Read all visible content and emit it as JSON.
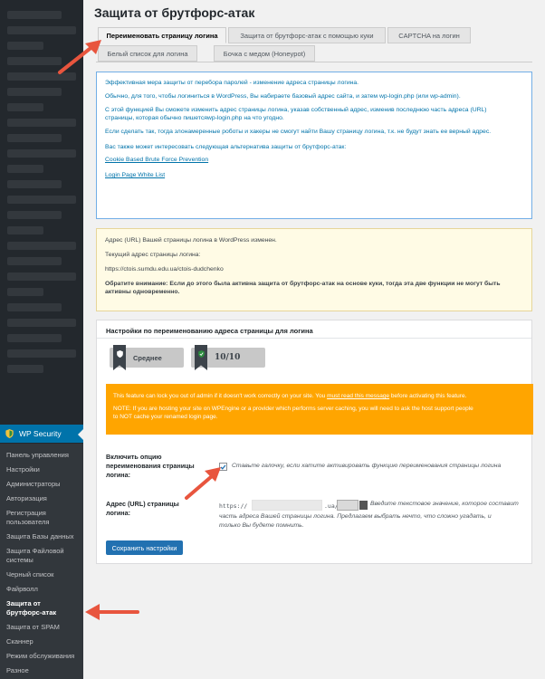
{
  "page": {
    "title": "Защита от брутфорс-атак"
  },
  "tabs": [
    {
      "label": "Переименовать страницу логина",
      "active": true
    },
    {
      "label": "Защита от брутфорс-атак с помощью куки",
      "active": false
    },
    {
      "label": "CAPTCHA на логин",
      "active": false
    },
    {
      "label": "Белый список для логина",
      "active": false
    },
    {
      "label": "Бочка с медом (Honeypot)",
      "active": false
    }
  ],
  "info_box": {
    "p1": "Эффективная мера защиты от перебора паролей - изменение адреса страницы логина.",
    "p2": "Обычно, для того, чтобы логиниться в WordPress, Вы набираете базовый адрес сайта, и затем wp-login.php (или wp-admin).",
    "p3_a": "С этой функцией Вы сможете изменить адрес страницы логина, указав собственный адрес, изменив последнюю часть адреса (URL)",
    "p3_b": "страницы, которая обычно пишетсяwp-login.php на что угодно.",
    "p4": "Если сделать так, тогда злонамеренные роботы и хакеры не смогут найти Вашу страницу логина, т.к. не будут знать ее верный адрес.",
    "p5": "Вас также может интересовать следующая альтернатива защиты от брутфорс-атак:",
    "link1": "Cookie Based Brute Force Prevention",
    "link2": "Login Page White List"
  },
  "warn_box": {
    "p1": "Адрес (URL) Вашей страницы логина в WordPress изменен.",
    "p2": "Текущий адрес страницы логина:",
    "p3": "https://ctois.sumdu.edu.ua/ctois-dudchenko",
    "p4_a": "Обратите внимание: Если до этого была активна защита от брутфорс-атак на основе куки, тогда эта две функции не могут быть",
    "p4_b": "активны одновременно."
  },
  "settings": {
    "heading": "Настройки по переименованию адреса страницы для логина",
    "badge_level": "Среднее",
    "badge_score": "10/10",
    "orange_p1_a": "This feature can lock you out of admin if it doesn't work correctly on your site. You ",
    "orange_link": "must read this message",
    "orange_p1_b": " before activating this feature.",
    "orange_p2_a": "NOTE: If you are hosting your site on WPEngine or a provider which performs server caching, you will need to ask the host support people",
    "orange_p2_b": "to NOT cache your renamed login page.",
    "enable_label_1": "Включить опцию",
    "enable_label_2": "переименования страницы",
    "enable_label_3": "логина:",
    "enable_checked": true,
    "enable_hint": "Ставьте галочку, если хатите активировать функцию переименования страницы логина",
    "url_label_1": "Адрес (URL) страницы",
    "url_label_2": "логина:",
    "url_prefix": "https://",
    "url_suffix": ".ua/",
    "url_hint_1": "Введите текстовое значение, которое составит",
    "url_hint_2": "часть адреса Вашей страницы логина. Предлагаем выбрать нечто, что сложно угадать, и",
    "url_hint_3": "только Вы будете помнить.",
    "save_label": "Сохранить настройки"
  },
  "sidebar": {
    "plugin_label": "WP Security",
    "items": [
      {
        "label": "Панель управления",
        "active": false
      },
      {
        "label": "Настройки",
        "active": false
      },
      {
        "label": "Администраторы",
        "active": false
      },
      {
        "label": "Авторизация",
        "active": false
      },
      {
        "label": "Регистрация пользователя",
        "active": false
      },
      {
        "label": "Защита Базы данных",
        "active": false
      },
      {
        "label": "Защита Файловой системы",
        "active": false
      },
      {
        "label": "Черный список",
        "active": false
      },
      {
        "label": "Файрволл",
        "active": false
      },
      {
        "label": "Защита от брутфорс-атак",
        "active": true
      },
      {
        "label": "Защита от SPAM",
        "active": false
      },
      {
        "label": "Сканнер",
        "active": false
      },
      {
        "label": "Режим обслуживания",
        "active": false
      },
      {
        "label": "Разное",
        "active": false
      }
    ]
  },
  "colors": {
    "accent": "#0073aa",
    "annotation_arrow": "#e8553e",
    "warning_orange": "#ffa500"
  }
}
